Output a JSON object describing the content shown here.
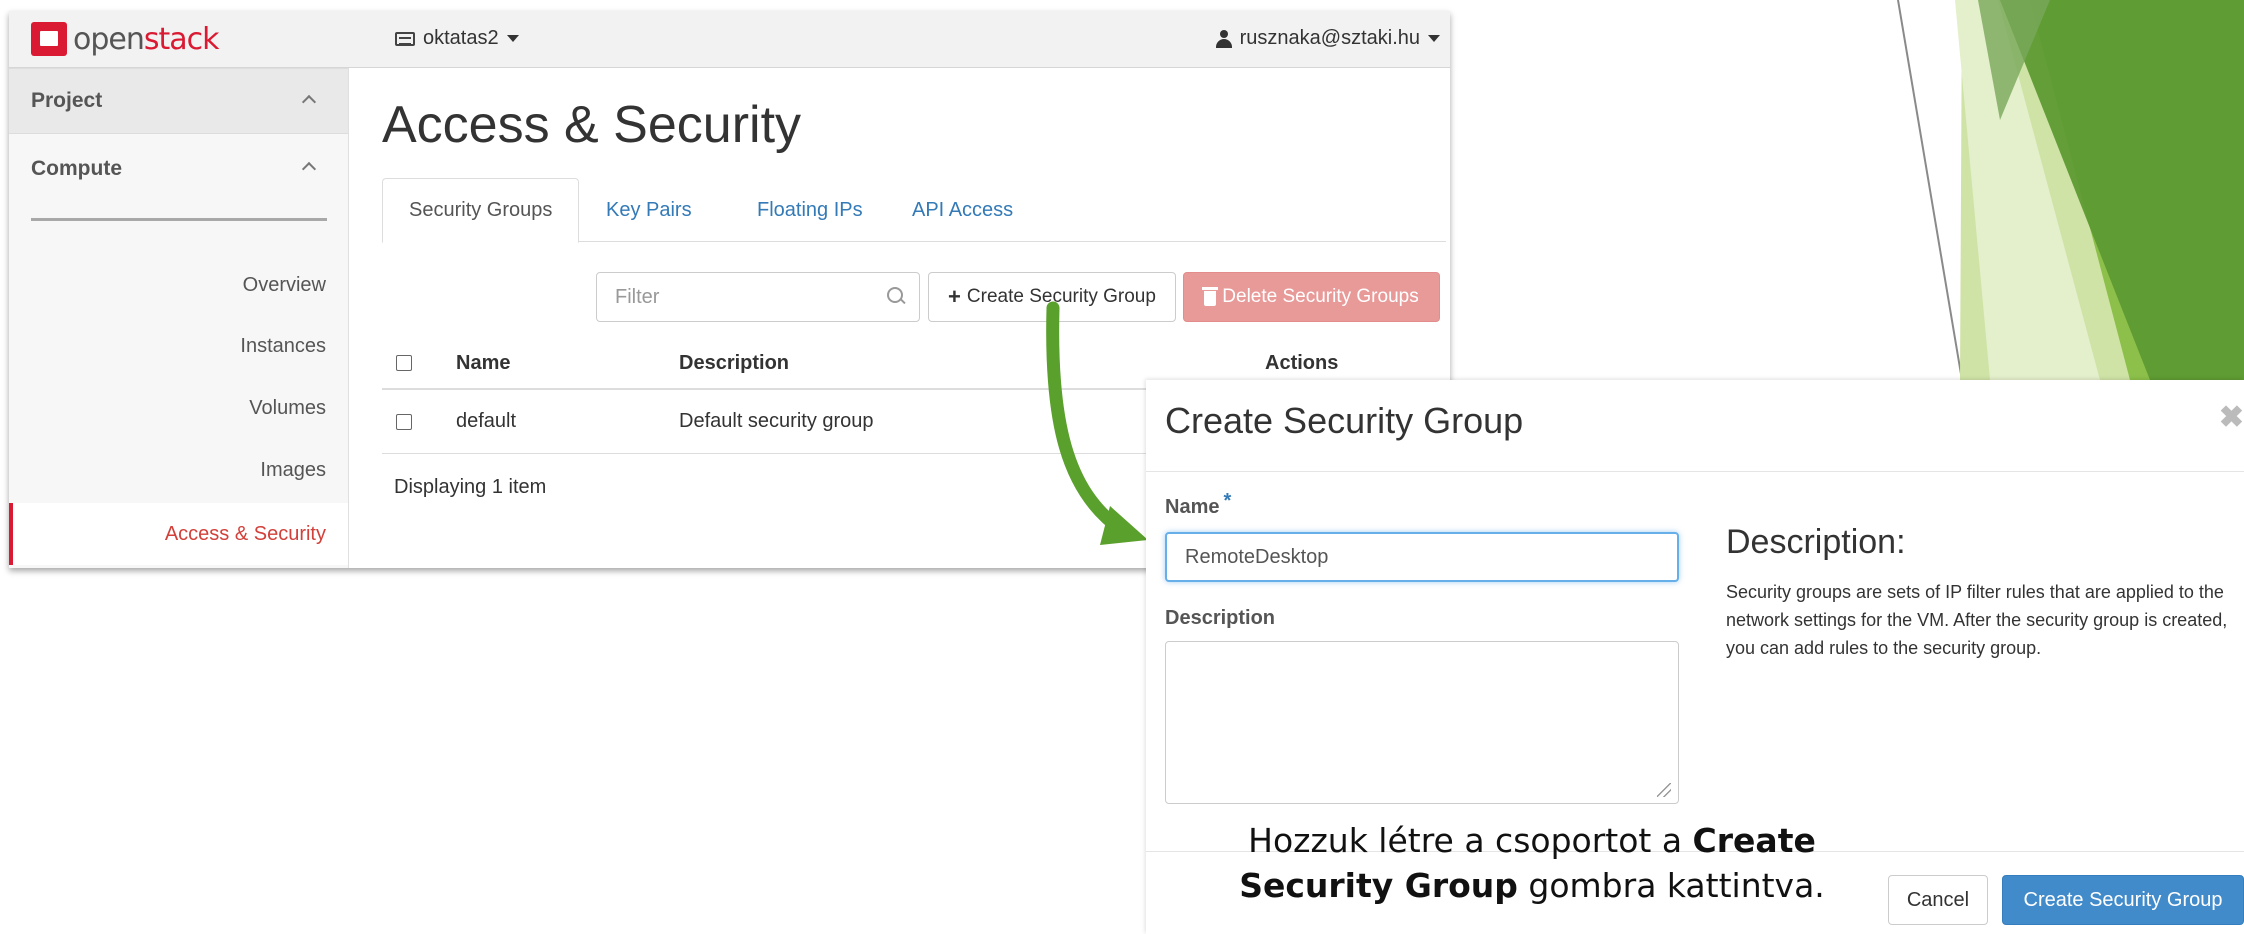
{
  "topbar": {
    "logo_open": "open",
    "logo_stack": "stack",
    "project": "oktatas2",
    "user": "rusznaka@sztaki.hu"
  },
  "sidebar": {
    "project_label": "Project",
    "compute_label": "Compute",
    "items": [
      {
        "label": "Overview"
      },
      {
        "label": "Instances"
      },
      {
        "label": "Volumes"
      },
      {
        "label": "Images"
      },
      {
        "label": "Access & Security",
        "active": true
      }
    ]
  },
  "main": {
    "title": "Access & Security",
    "tabs": [
      {
        "label": "Security Groups",
        "active": true
      },
      {
        "label": "Key Pairs"
      },
      {
        "label": "Floating IPs"
      },
      {
        "label": "API Access"
      }
    ],
    "filter_placeholder": "Filter",
    "create_button": "Create Security Group",
    "delete_button": "Delete Security Groups",
    "table": {
      "columns": [
        "Name",
        "Description",
        "Actions"
      ],
      "rows": [
        {
          "name": "default",
          "description": "Default security group"
        }
      ],
      "footer": "Displaying 1 item"
    }
  },
  "modal": {
    "title": "Create Security Group",
    "close_symbol": "✖",
    "name_label": "Name",
    "required_mark": "*",
    "name_value": "RemoteDesktop",
    "description_label": "Description",
    "help_title": "Description:",
    "help_text": "Security groups are sets of IP filter rules that are applied to the network settings for the VM. After the security group is created, you can add rules to the security group.",
    "cancel_button": "Cancel",
    "submit_button": "Create Security Group"
  },
  "caption": {
    "line1_plain": "Hozzuk létre a csoportot a ",
    "line1_bold": "Create",
    "line2_bold": "Security Group",
    "line2_plain": " gombra kattintva."
  },
  "colors": {
    "brand_red": "#da1a32",
    "link_blue": "#337ab7",
    "primary_blue": "#428bca",
    "danger_light": "#e89a99",
    "arrow_green": "#5aa02c"
  }
}
